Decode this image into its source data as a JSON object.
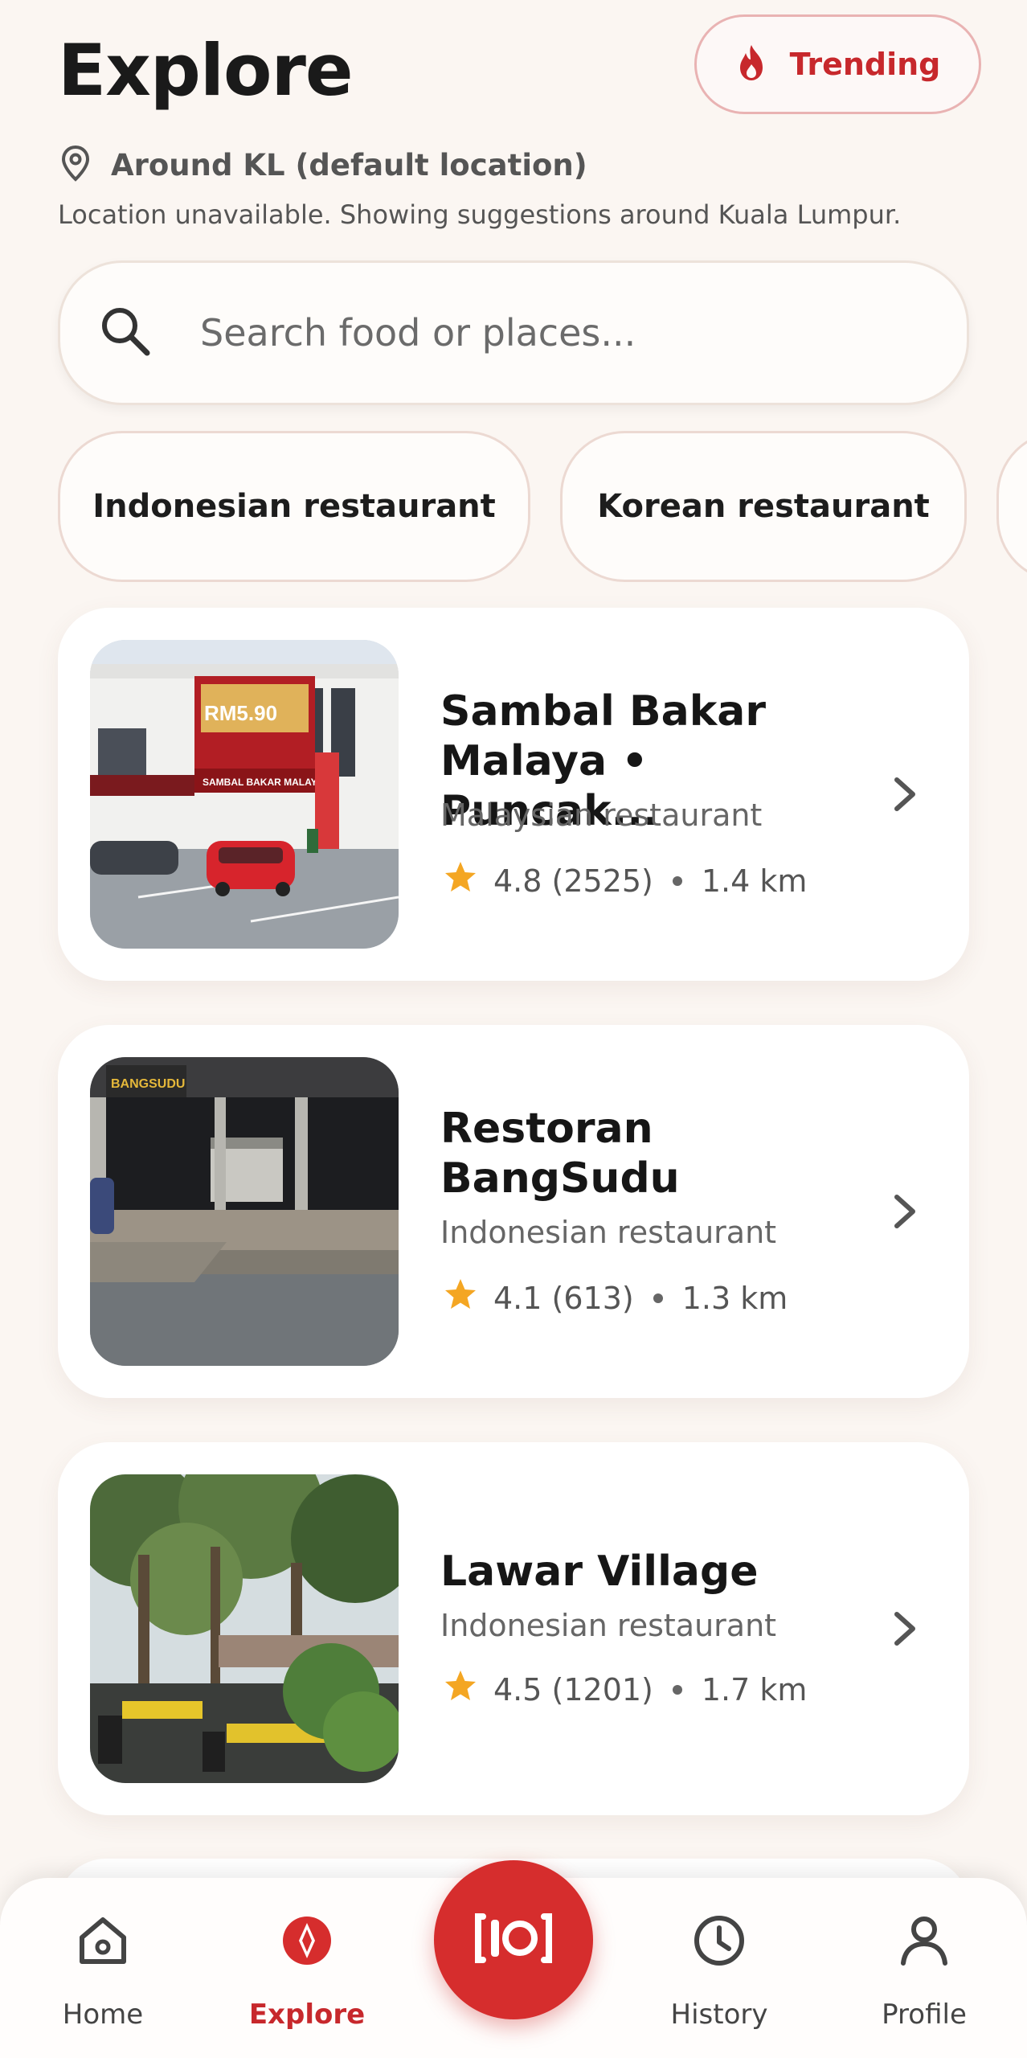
{
  "header": {
    "title": "Explore",
    "trending_label": "Trending",
    "location_label": "Around KL (default location)",
    "location_note": "Location unavailable. Showing suggestions around Kuala Lumpur."
  },
  "search": {
    "placeholder": "Search food or places..."
  },
  "chips": [
    "Indonesian restaurant",
    "Korean restaurant"
  ],
  "restaurants": [
    {
      "name_line1": "Sambal Bakar",
      "name_line2": "Malaya • Puncak...",
      "category": "Malaysian restaurant",
      "rating": "4.8 (2525)",
      "distance": "1.4 km"
    },
    {
      "name_line1": "Restoran",
      "name_line2": "BangSudu",
      "category": "Indonesian restaurant",
      "rating": "4.1 (613)",
      "distance": "1.3 km"
    },
    {
      "name_line1": "Lawar Village",
      "name_line2": "",
      "category": "Indonesian restaurant",
      "rating": "4.5 (1201)",
      "distance": "1.7 km"
    }
  ],
  "photo_signage": {
    "banner_price": "RM5.90",
    "banner_sign": "SAMBAL BAKAR MALAYA",
    "shop_sign": "BANGSUDU"
  },
  "nav": {
    "home": "Home",
    "explore": "Explore",
    "history": "History",
    "profile": "Profile"
  },
  "icons": {
    "trending": "fire-icon",
    "location": "location-pin-icon",
    "search": "search-icon",
    "rating": "star-icon",
    "chevron": "chevron-right-icon",
    "home": "home-icon",
    "explore": "compass-icon",
    "scan": "scan-camera-icon",
    "history": "clock-icon",
    "profile": "user-icon"
  },
  "colors": {
    "accent": "#d62d2d",
    "star": "#f4a623",
    "background": "#fbf6f2"
  }
}
